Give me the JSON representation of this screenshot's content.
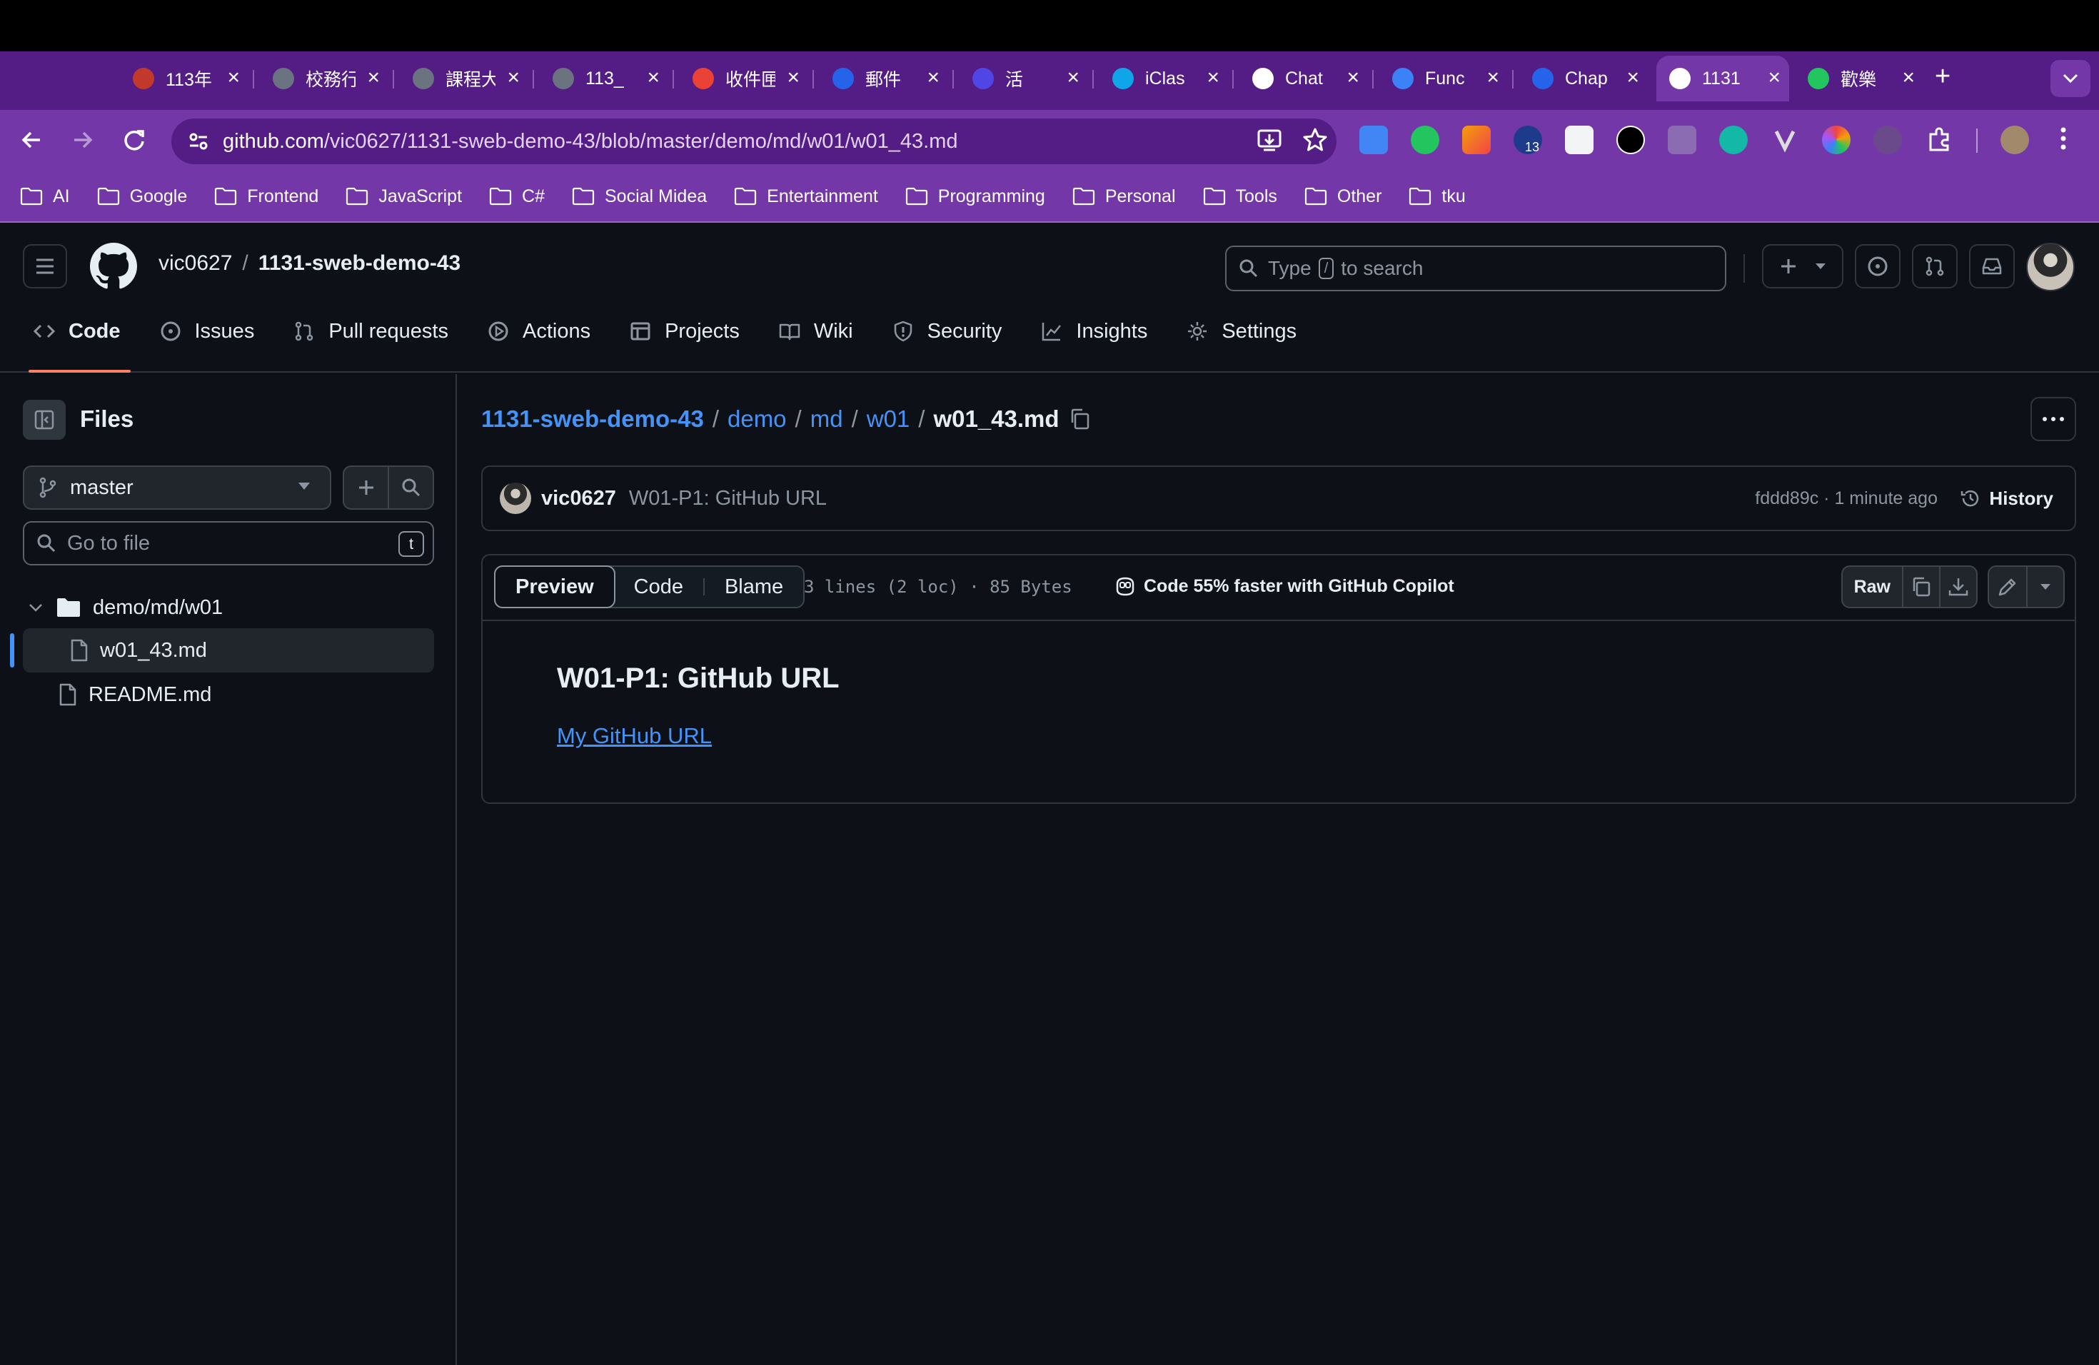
{
  "browser": {
    "tabs": [
      {
        "title": "113年",
        "icon_color": "#c0392b"
      },
      {
        "title": "校務行",
        "icon_color": "#6b7280"
      },
      {
        "title": "課程大",
        "icon_color": "#6b7280"
      },
      {
        "title": "113_",
        "icon_color": "#6b7280"
      },
      {
        "title": "收件匣",
        "icon_color": "#ea4335"
      },
      {
        "title": "郵件",
        "icon_color": "#2563eb"
      },
      {
        "title": "活",
        "icon_color": "#4f46e5"
      },
      {
        "title": "iClas",
        "icon_color": "#0ea5e9"
      },
      {
        "title": "Chat",
        "icon_color": "#ffffff"
      },
      {
        "title": "Func",
        "icon_color": "#3b82f6"
      },
      {
        "title": "Chap",
        "icon_color": "#2563eb"
      },
      {
        "title": "1131",
        "icon_color": "#ffffff",
        "active": true
      },
      {
        "title": "歡樂",
        "icon_color": "#22c55e"
      }
    ],
    "url_host": "github.com",
    "url_path": "/vic0627/1131-sweb-demo-43/blob/master/demo/md/w01/w01_43.md",
    "bookmarks": [
      "AI",
      "Google",
      "Frontend",
      "JavaScript",
      "C#",
      "Social Midea",
      "Entertainment",
      "Programming",
      "Personal",
      "Tools",
      "Other",
      "tku"
    ],
    "extension_badge": "13"
  },
  "header": {
    "owner": "vic0627",
    "repo": "1131-sweb-demo-43",
    "search_prefix": "Type",
    "search_key": "/",
    "search_suffix": "to search"
  },
  "reponav": {
    "code": "Code",
    "issues": "Issues",
    "pulls": "Pull requests",
    "actions": "Actions",
    "projects": "Projects",
    "wiki": "Wiki",
    "security": "Security",
    "insights": "Insights",
    "settings": "Settings"
  },
  "sidebar": {
    "title": "Files",
    "branch": "master",
    "goto_placeholder": "Go to file",
    "goto_key": "t",
    "tree": {
      "folder": "demo/md/w01",
      "active_file": "w01_43.md",
      "other_file": "README.md"
    }
  },
  "breadcrumb": {
    "repo": "1131-sweb-demo-43",
    "seg1": "demo",
    "seg2": "md",
    "seg3": "w01",
    "file": "w01_43.md",
    "sep": "/"
  },
  "commit": {
    "author": "vic0627",
    "message": "W01-P1: GitHub URL",
    "meta": "fddd89c · 1 minute ago",
    "history": "History"
  },
  "file": {
    "tab_preview": "Preview",
    "tab_code": "Code",
    "tab_blame": "Blame",
    "info": "3 lines (2 loc) · 85 Bytes",
    "copilot": "Code 55% faster with GitHub Copilot",
    "raw": "Raw"
  },
  "preview": {
    "heading": "W01-P1: GitHub URL",
    "link": "My GitHub URL"
  }
}
